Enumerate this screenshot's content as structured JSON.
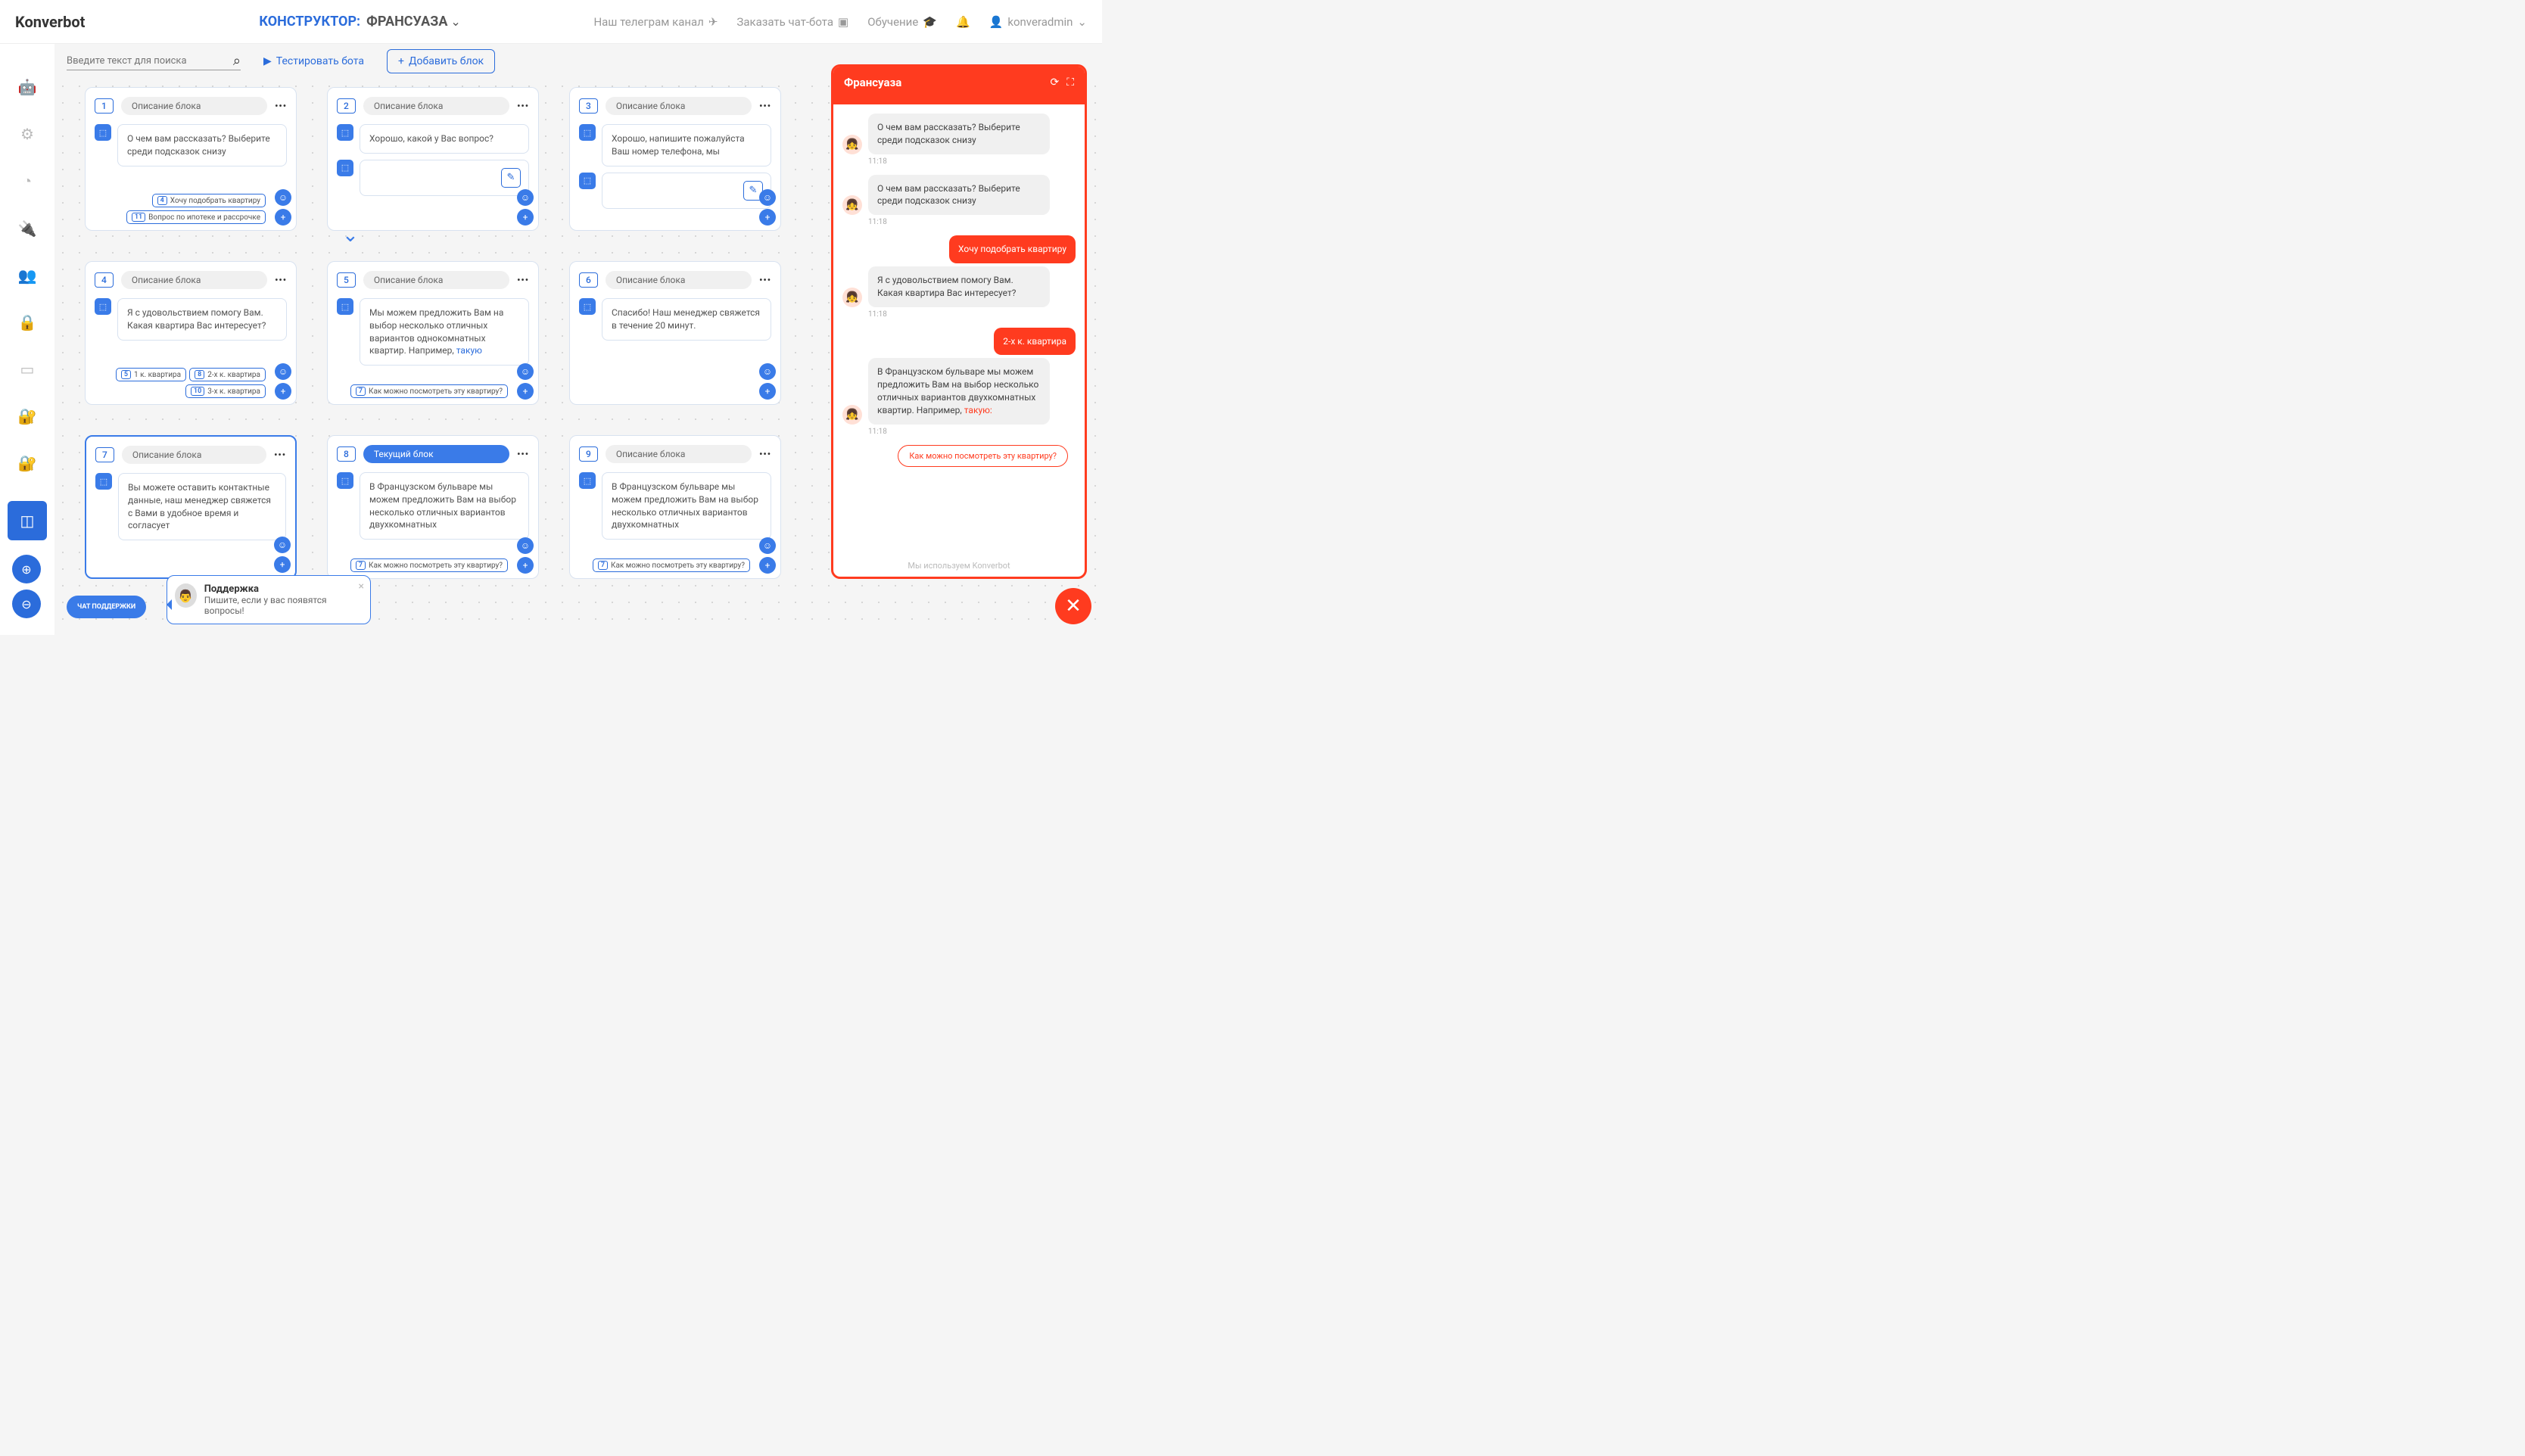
{
  "header": {
    "logo": "Konverbot",
    "constructor_label": "КОНСТРУКТОР:",
    "bot_name": "ФРАНСУАЗА",
    "links": {
      "telegram": "Наш телеграм канал",
      "order": "Заказать чат-бота",
      "learn": "Обучение"
    },
    "user": "konveradmin"
  },
  "toolbar": {
    "search_placeholder": "Введите текст для поиска",
    "test_label": "Тестировать бота",
    "add_label": "Добавить блок"
  },
  "blocks": [
    {
      "num": "1",
      "desc": "Описание блока",
      "msg": "О чем вам рассказать? Выберите среди подсказок снизу",
      "chips": [
        {
          "n": "4",
          "t": "Хочу подобрать квартиру"
        },
        {
          "n": "11",
          "t": "Вопрос по ипотеке и рассрочке"
        }
      ]
    },
    {
      "num": "2",
      "desc": "Описание блока",
      "msg": "Хорошо, какой у Вас вопрос?",
      "has_input": true
    },
    {
      "num": "3",
      "desc": "Описание блока",
      "msg": "Хорошо, напишите пожалуйста Ваш номер телефона, мы",
      "has_input": true
    },
    {
      "num": "4",
      "desc": "Описание блока",
      "msg": "Я с удовольствием помогу Вам. Какая квартира Вас интересует?",
      "chips_row": [
        {
          "n": "5",
          "t": "1 к. квартира"
        },
        {
          "n": "8",
          "t": "2-х к. квартира"
        }
      ],
      "chips": [
        {
          "n": "10",
          "t": "3-х к. квартира"
        }
      ]
    },
    {
      "num": "5",
      "desc": "Описание блока",
      "msg": "Мы можем предложить Вам на выбор несколько отличных вариантов однокомнатных квартир. Например, ",
      "link": "такую",
      "selected": true,
      "chips": [
        {
          "n": "7",
          "t": "Как можно посмотреть эту квартиру?"
        }
      ]
    },
    {
      "num": "6",
      "desc": "Описание блока",
      "msg": "Спасибо! Наш менеджер свяжется в течение 20 минут."
    },
    {
      "num": "7",
      "desc": "Описание блока",
      "msg": "Вы можете оставить контактные данные, наш менеджер свяжется с Вами в удобное время и согласует",
      "bordered": true
    },
    {
      "num": "8",
      "desc": "Текущий блок",
      "msg": "В Французском бульваре мы можем предложить Вам на выбор несколько отличных вариантов двухкомнатных",
      "current": true,
      "chips": [
        {
          "n": "7",
          "t": "Как можно посмотреть эту квартиру?"
        }
      ]
    },
    {
      "num": "9",
      "desc": "Описание блока",
      "msg": "В Французском бульваре мы можем предложить Вам на выбор несколько отличных вариантов двухкомнатных",
      "chips": [
        {
          "n": "7",
          "t": "Как можно посмотреть эту квартиру?"
        }
      ]
    }
  ],
  "preview": {
    "title": "Франсуаза",
    "messages": [
      {
        "type": "bot",
        "text": "О чем вам рассказать? Выберите среди подсказок снизу",
        "time": "11:18"
      },
      {
        "type": "bot",
        "text": "О чем вам рассказать? Выберите среди подсказок снизу",
        "time": "11:18"
      },
      {
        "type": "user",
        "text": "Хочу подобрать квартиру"
      },
      {
        "type": "bot",
        "text": "Я с удовольствием помогу Вам. Какая квартира Вас интересует?",
        "time": "11:18"
      },
      {
        "type": "user",
        "text": "2-х к. квартира"
      },
      {
        "type": "bot",
        "text": "В Французском бульваре мы можем предложить Вам на выбор несколько отличных вариантов двухкомнатных квартир. Например, ",
        "link": "такую:",
        "time": "11:18"
      }
    ],
    "suggestion": "Как можно посмотреть эту квартиру?",
    "footer": "Мы используем Konverbot"
  },
  "support": {
    "chip": "ЧАТ ПОДДЕРЖКИ",
    "title": "Поддержка",
    "text": "Пишите, если у вас появятся вопросы!"
  }
}
